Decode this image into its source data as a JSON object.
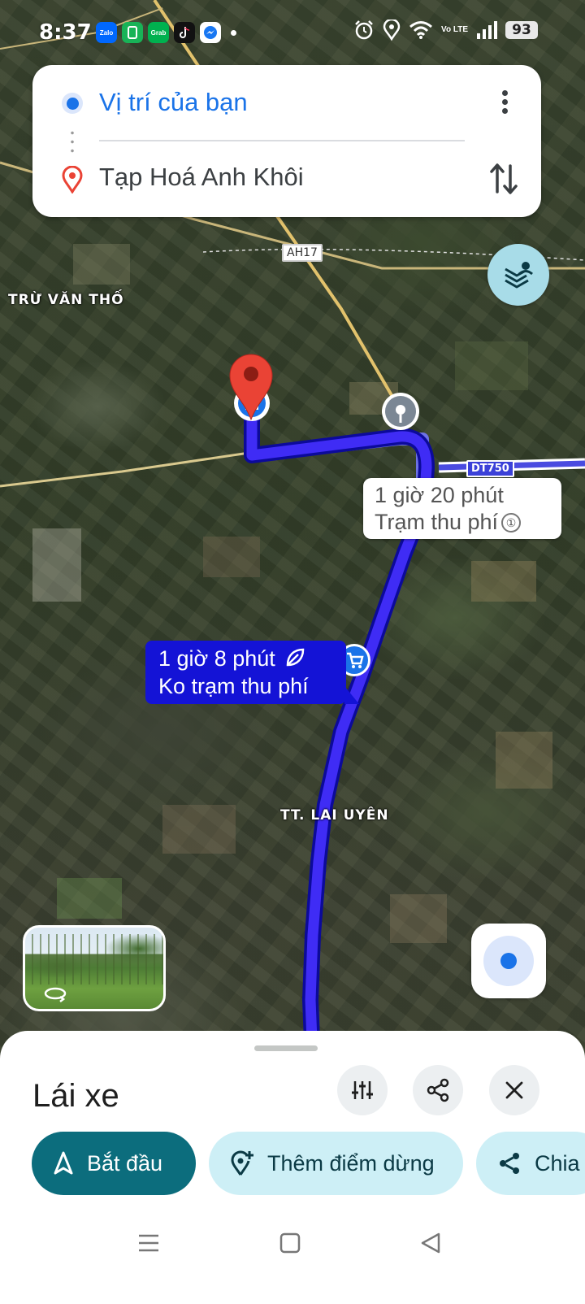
{
  "status_bar": {
    "time": "8:37",
    "apps": [
      {
        "name": "zalo",
        "label": "Zalo",
        "color": "#0068ff"
      },
      {
        "name": "wallet",
        "label": "",
        "color": "#18b357"
      },
      {
        "name": "grab",
        "label": "Grab",
        "color": "#00b14f"
      },
      {
        "name": "tiktok",
        "label": "",
        "color": "#111111"
      },
      {
        "name": "messenger",
        "label": "",
        "color": "#1877f2"
      }
    ],
    "network": "Vo LTE",
    "battery": "93"
  },
  "route_card": {
    "origin": "Vị trí của bạn",
    "destination": "Tạp Hoá Anh Khôi"
  },
  "map": {
    "labels": {
      "area_west": "TRỪ VĂN THỐ",
      "town": "TT. LAI UYÊN"
    },
    "shields": {
      "ah17": "AH17",
      "dt750": "DT750"
    },
    "route_colors": {
      "selected": "#1413d6",
      "alternate": "#8d96ea"
    }
  },
  "callouts": {
    "alternate": {
      "duration": "1 giờ 20 phút",
      "note": "Trạm thu phí",
      "toll_icon": "①"
    },
    "selected": {
      "duration": "1 giờ 8 phút",
      "note": "Ko trạm thu phí"
    }
  },
  "sheet": {
    "mode_title": "Lái xe",
    "chips": {
      "start": "Bắt đầu",
      "add_stop": "Thêm điểm dừng",
      "share": "Chia sẻ"
    }
  },
  "colors": {
    "accent": "#1a73e8",
    "start_chip": "#0c6d7d",
    "secondary_chip": "#cdeff6",
    "destination_pin": "#ea4335"
  }
}
